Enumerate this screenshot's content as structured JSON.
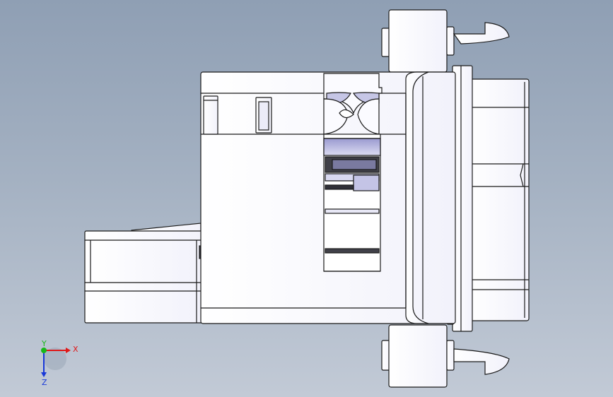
{
  "viewport": {
    "background_top": "#8f9fb4",
    "background_bottom": "#c2cad6",
    "part_fill": "#fbfbff",
    "part_stroke": "#1a1a1a",
    "slot_fill": "#b8b8e0",
    "slot_dark": "#404048"
  },
  "triad": {
    "x_label": "X",
    "y_label": "Y",
    "z_label": "Z",
    "x_color": "#e01818",
    "y_color": "#18b818",
    "z_color": "#1838d8"
  }
}
